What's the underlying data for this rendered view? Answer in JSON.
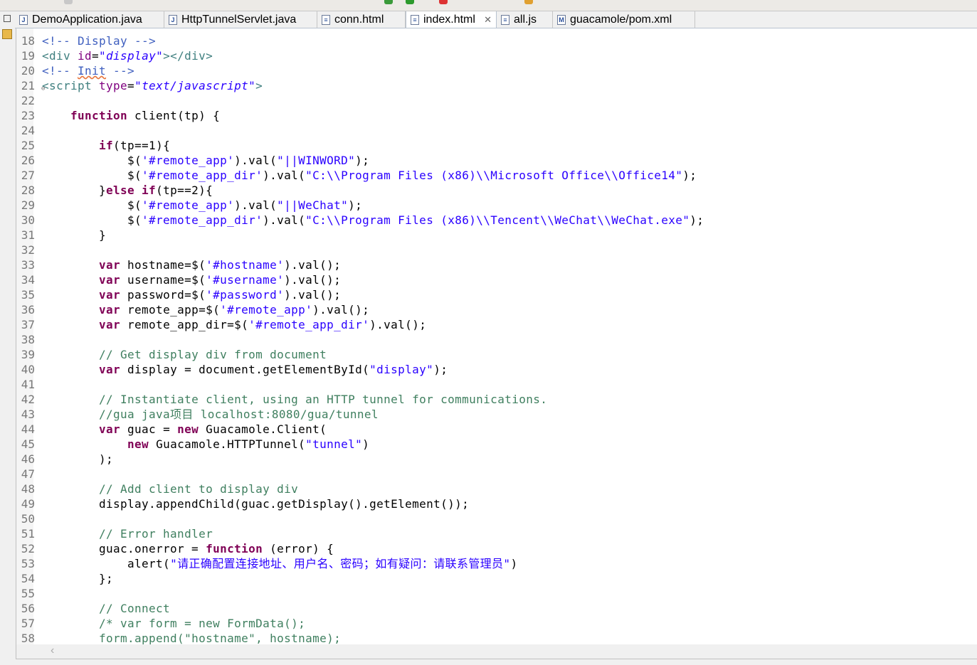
{
  "tabs": [
    {
      "label": "DemoApplication.java",
      "icon": "J",
      "active": false
    },
    {
      "label": "HttpTunnelServlet.java",
      "icon": "J",
      "active": false
    },
    {
      "label": "conn.html",
      "icon": "≡",
      "active": false
    },
    {
      "label": "index.html",
      "icon": "≡",
      "active": true,
      "close": "✕"
    },
    {
      "label": "all.js",
      "icon": "≡",
      "active": false
    },
    {
      "label": "guacamole/pom.xml",
      "icon": "M",
      "active": false
    }
  ],
  "scroll_left": "‹",
  "lines": [
    {
      "n": "18",
      "s": [
        [
          "hc",
          "<!-- Display -->"
        ]
      ]
    },
    {
      "n": "19",
      "s": [
        [
          "tag",
          "<div "
        ],
        [
          "an",
          "id"
        ],
        [
          "d",
          "="
        ],
        [
          "av",
          "\"display\""
        ],
        [
          "tag",
          "></div>"
        ]
      ]
    },
    {
      "n": "20",
      "s": [
        [
          "hc",
          "<!-- "
        ],
        [
          "hc sq",
          "Init"
        ],
        [
          "hc",
          " -->"
        ]
      ]
    },
    {
      "n": "21",
      "fold": true,
      "s": [
        [
          "tag",
          "<script "
        ],
        [
          "an",
          "type"
        ],
        [
          "d",
          "="
        ],
        [
          "av",
          "\"text/javascript\""
        ],
        [
          "tag",
          ">"
        ]
      ]
    },
    {
      "n": "22",
      "s": []
    },
    {
      "n": "23",
      "s": [
        [
          "d",
          "    "
        ],
        [
          "kw",
          "function"
        ],
        [
          "d",
          " client(tp) {"
        ]
      ]
    },
    {
      "n": "24",
      "s": []
    },
    {
      "n": "25",
      "s": [
        [
          "d",
          "        "
        ],
        [
          "kw",
          "if"
        ],
        [
          "d",
          "(tp==1){"
        ]
      ]
    },
    {
      "n": "26",
      "s": [
        [
          "d",
          "            $("
        ],
        [
          "str",
          "'#remote_app'"
        ],
        [
          "d",
          ").val("
        ],
        [
          "str",
          "\"||WINWORD\""
        ],
        [
          "d",
          ");"
        ]
      ]
    },
    {
      "n": "27",
      "s": [
        [
          "d",
          "            $("
        ],
        [
          "str",
          "'#remote_app_dir'"
        ],
        [
          "d",
          ").val("
        ],
        [
          "str",
          "\"C:\\\\Program Files (x86)\\\\Microsoft Office\\\\Office14\""
        ],
        [
          "d",
          ");"
        ]
      ]
    },
    {
      "n": "28",
      "s": [
        [
          "d",
          "        }"
        ],
        [
          "kw",
          "else if"
        ],
        [
          "d",
          "(tp==2){"
        ]
      ]
    },
    {
      "n": "29",
      "s": [
        [
          "d",
          "            $("
        ],
        [
          "str",
          "'#remote_app'"
        ],
        [
          "d",
          ").val("
        ],
        [
          "str",
          "\"||WeChat\""
        ],
        [
          "d",
          ");"
        ]
      ]
    },
    {
      "n": "30",
      "s": [
        [
          "d",
          "            $("
        ],
        [
          "str",
          "'#remote_app_dir'"
        ],
        [
          "d",
          ").val("
        ],
        [
          "str",
          "\"C:\\\\Program Files (x86)\\\\Tencent\\\\WeChat\\\\WeChat.exe\""
        ],
        [
          "d",
          ");"
        ]
      ]
    },
    {
      "n": "31",
      "s": [
        [
          "d",
          "        }"
        ]
      ]
    },
    {
      "n": "32",
      "s": []
    },
    {
      "n": "33",
      "s": [
        [
          "d",
          "        "
        ],
        [
          "kw",
          "var"
        ],
        [
          "d",
          " hostname=$("
        ],
        [
          "str",
          "'#hostname'"
        ],
        [
          "d",
          ").val();"
        ]
      ]
    },
    {
      "n": "34",
      "s": [
        [
          "d",
          "        "
        ],
        [
          "kw",
          "var"
        ],
        [
          "d",
          " username=$("
        ],
        [
          "str",
          "'#username'"
        ],
        [
          "d",
          ").val();"
        ]
      ]
    },
    {
      "n": "35",
      "s": [
        [
          "d",
          "        "
        ],
        [
          "kw",
          "var"
        ],
        [
          "d",
          " password=$("
        ],
        [
          "str",
          "'#password'"
        ],
        [
          "d",
          ").val();"
        ]
      ]
    },
    {
      "n": "36",
      "s": [
        [
          "d",
          "        "
        ],
        [
          "kw",
          "var"
        ],
        [
          "d",
          " remote_app=$("
        ],
        [
          "str",
          "'#remote_app'"
        ],
        [
          "d",
          ").val();"
        ]
      ]
    },
    {
      "n": "37",
      "s": [
        [
          "d",
          "        "
        ],
        [
          "kw",
          "var"
        ],
        [
          "d",
          " remote_app_dir=$("
        ],
        [
          "str",
          "'#remote_app_dir'"
        ],
        [
          "d",
          ").val();"
        ]
      ]
    },
    {
      "n": "38",
      "s": []
    },
    {
      "n": "39",
      "s": [
        [
          "d",
          "        "
        ],
        [
          "cm",
          "// Get display div from document"
        ]
      ]
    },
    {
      "n": "40",
      "s": [
        [
          "d",
          "        "
        ],
        [
          "kw",
          "var"
        ],
        [
          "d",
          " display = document.getElementById("
        ],
        [
          "str",
          "\"display\""
        ],
        [
          "d",
          ");"
        ]
      ]
    },
    {
      "n": "41",
      "s": []
    },
    {
      "n": "42",
      "s": [
        [
          "d",
          "        "
        ],
        [
          "cm",
          "// Instantiate client, using an HTTP tunnel for communications."
        ]
      ]
    },
    {
      "n": "43",
      "s": [
        [
          "d",
          "        "
        ],
        [
          "cm",
          "//gua java项目 localhost:8080/gua/tunnel"
        ]
      ]
    },
    {
      "n": "44",
      "s": [
        [
          "d",
          "        "
        ],
        [
          "kw",
          "var"
        ],
        [
          "d",
          " guac = "
        ],
        [
          "kw",
          "new"
        ],
        [
          "d",
          " Guacamole.Client("
        ]
      ]
    },
    {
      "n": "45",
      "s": [
        [
          "d",
          "            "
        ],
        [
          "kw",
          "new"
        ],
        [
          "d",
          " Guacamole.HTTPTunnel("
        ],
        [
          "str",
          "\"tunnel\""
        ],
        [
          "d",
          ")"
        ]
      ]
    },
    {
      "n": "46",
      "s": [
        [
          "d",
          "        );"
        ]
      ]
    },
    {
      "n": "47",
      "s": []
    },
    {
      "n": "48",
      "s": [
        [
          "d",
          "        "
        ],
        [
          "cm",
          "// Add client to display div"
        ]
      ]
    },
    {
      "n": "49",
      "s": [
        [
          "d",
          "        display.appendChild(guac.getDisplay().getElement());"
        ]
      ]
    },
    {
      "n": "50",
      "s": []
    },
    {
      "n": "51",
      "s": [
        [
          "d",
          "        "
        ],
        [
          "cm",
          "// Error handler"
        ]
      ]
    },
    {
      "n": "52",
      "s": [
        [
          "d",
          "        guac.onerror = "
        ],
        [
          "kw",
          "function"
        ],
        [
          "d",
          " (error) {"
        ]
      ]
    },
    {
      "n": "53",
      "s": [
        [
          "d",
          "            alert("
        ],
        [
          "str",
          "\"请正确配置连接地址、用户名、密码；如有疑问：请联系管理员\""
        ],
        [
          "d",
          ")"
        ]
      ]
    },
    {
      "n": "54",
      "s": [
        [
          "d",
          "        };"
        ]
      ]
    },
    {
      "n": "55",
      "s": []
    },
    {
      "n": "56",
      "s": [
        [
          "d",
          "        "
        ],
        [
          "cm",
          "// Connect"
        ]
      ]
    },
    {
      "n": "57",
      "s": [
        [
          "d",
          "        "
        ],
        [
          "cm",
          "/* var form = new FormData();"
        ]
      ]
    },
    {
      "n": "58",
      "s": [
        [
          "d",
          "        "
        ],
        [
          "cm",
          "form.append(\"hostname\", hostname);"
        ]
      ]
    }
  ]
}
